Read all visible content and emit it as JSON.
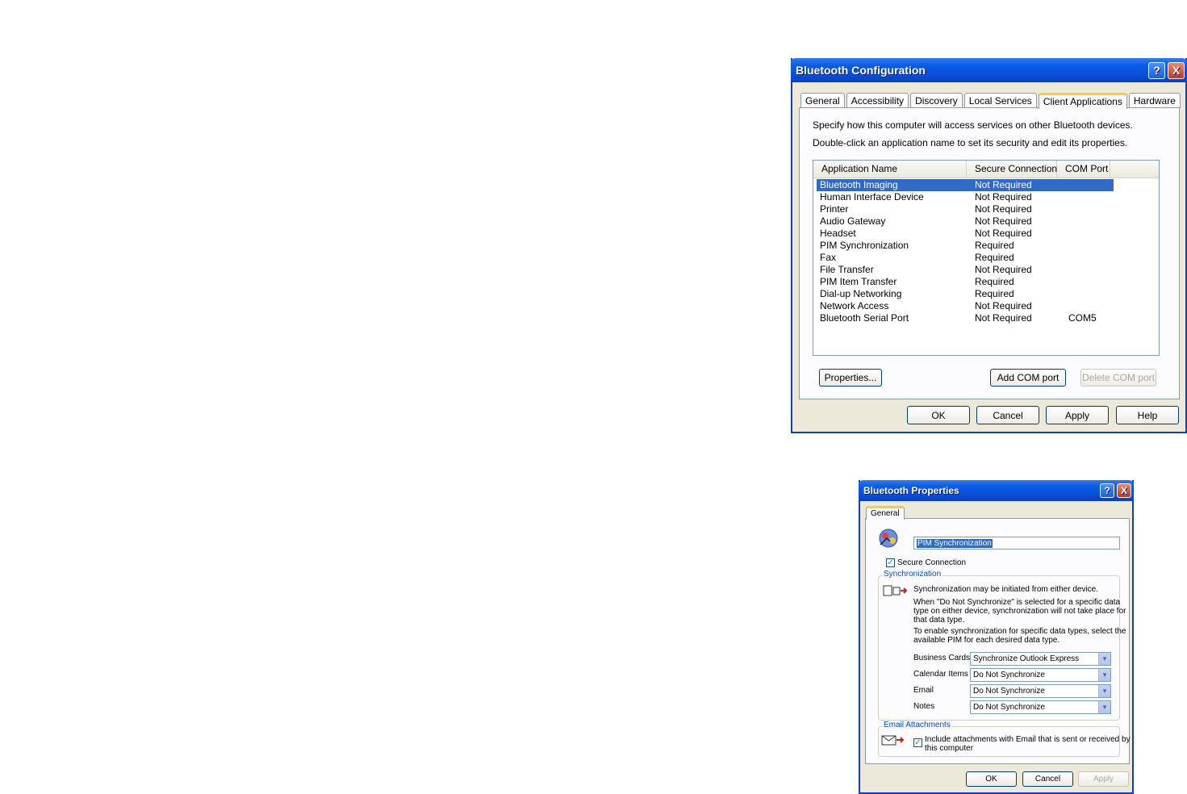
{
  "config_dialog": {
    "title": "Bluetooth Configuration",
    "tabs": [
      {
        "label": "General"
      },
      {
        "label": "Accessibility"
      },
      {
        "label": "Discovery"
      },
      {
        "label": "Local Services"
      },
      {
        "label": "Client Applications",
        "active": true
      },
      {
        "label": "Hardware"
      }
    ],
    "description_1": "Specify how this computer will access services on other Bluetooth devices.",
    "description_2": "Double-click an application name to set its security and edit its properties.",
    "columns": {
      "name": "Application Name",
      "secure": "Secure Connection",
      "port": "COM Port"
    },
    "rows": [
      {
        "name": "Bluetooth Imaging",
        "secure": "Not Required",
        "port": "",
        "selected": true
      },
      {
        "name": "Human Interface Device",
        "secure": "Not Required",
        "port": ""
      },
      {
        "name": "Printer",
        "secure": "Not Required",
        "port": ""
      },
      {
        "name": "Audio Gateway",
        "secure": "Not Required",
        "port": ""
      },
      {
        "name": "Headset",
        "secure": "Not Required",
        "port": ""
      },
      {
        "name": "PIM Synchronization",
        "secure": "Required",
        "port": ""
      },
      {
        "name": "Fax",
        "secure": "Required",
        "port": ""
      },
      {
        "name": "File Transfer",
        "secure": "Not Required",
        "port": ""
      },
      {
        "name": "PIM Item Transfer",
        "secure": "Required",
        "port": ""
      },
      {
        "name": "Dial-up Networking",
        "secure": "Required",
        "port": ""
      },
      {
        "name": "Network Access",
        "secure": "Not Required",
        "port": ""
      },
      {
        "name": "Bluetooth Serial Port",
        "secure": "Not Required",
        "port": "COM5"
      }
    ],
    "properties_label": "Properties...",
    "add_com_label": "Add COM port",
    "delete_com_label": "Delete COM port",
    "ok_label": "OK",
    "cancel_label": "Cancel",
    "apply_label": "Apply",
    "help_label": "Help",
    "help_glyph": "?",
    "close_glyph": "X"
  },
  "props_dialog": {
    "title": "Bluetooth Properties",
    "tab_label": "General",
    "name_value": "PIM Synchronization",
    "secure_label": "Secure Connection",
    "sync_group_label": "Synchronization",
    "sync_text_1": "Synchronization may be initiated from either device.",
    "sync_text_2a": "When \"Do Not Synchronize\" is selected for a specific data",
    "sync_text_2b": "type on either device, synchronization will not take place for",
    "sync_text_2c": "that data type.",
    "sync_text_3a": "To enable synchronization for specific data types, select the",
    "sync_text_3b": "available PIM for each desired data type.",
    "fields": [
      {
        "label": "Business Cards",
        "value": "Synchronize Outlook Express"
      },
      {
        "label": "Calendar Items",
        "value": "Do Not Synchronize"
      },
      {
        "label": "Email",
        "value": "Do Not Synchronize"
      },
      {
        "label": "Notes",
        "value": "Do Not Synchronize"
      }
    ],
    "attach_group_label": "Email Attachments",
    "attach_text_1": "Include attachments with Email that is sent or received by",
    "attach_text_2": "this computer",
    "ok_label": "OK",
    "cancel_label": "Cancel",
    "apply_label": "Apply",
    "help_glyph": "?",
    "close_glyph": "X",
    "check_glyph": "✓",
    "dropdown_glyph": "▾"
  }
}
